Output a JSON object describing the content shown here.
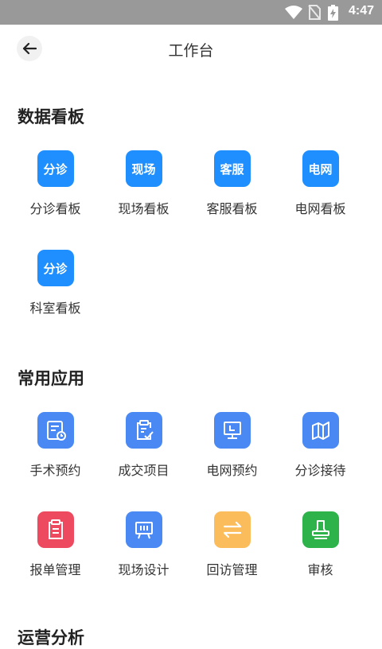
{
  "status": {
    "time": "4:47"
  },
  "header": {
    "title": "工作台"
  },
  "sections": [
    {
      "title": "数据看板"
    },
    {
      "title": "常用应用"
    },
    {
      "title": "运营分析"
    }
  ],
  "dashboard": [
    {
      "tile_text": "分诊",
      "label": "分诊看板"
    },
    {
      "tile_text": "现场",
      "label": "现场看板"
    },
    {
      "tile_text": "客服",
      "label": "客服看板"
    },
    {
      "tile_text": "电网",
      "label": "电网看板"
    },
    {
      "tile_text": "分诊",
      "label": "科室看板"
    }
  ],
  "apps": [
    {
      "label": "手术预约",
      "icon": "calendar-clock-icon",
      "color": "#4a89f3"
    },
    {
      "label": "成交项目",
      "icon": "clipboard-check-icon",
      "color": "#4a89f3"
    },
    {
      "label": "电网预约",
      "icon": "monitor-icon",
      "color": "#4a89f3"
    },
    {
      "label": "分诊接待",
      "icon": "map-icon",
      "color": "#4a89f3"
    },
    {
      "label": "报单管理",
      "icon": "clipboard-icon",
      "color": "#ed4a60"
    },
    {
      "label": "现场设计",
      "icon": "easel-icon",
      "color": "#4a89f3"
    },
    {
      "label": "回访管理",
      "icon": "swap-arrows-icon",
      "color": "#fbbd5c"
    },
    {
      "label": "审核",
      "icon": "stamp-icon",
      "color": "#2db34a"
    }
  ],
  "colors": {
    "dashboard_tile": "#1f8fff"
  }
}
